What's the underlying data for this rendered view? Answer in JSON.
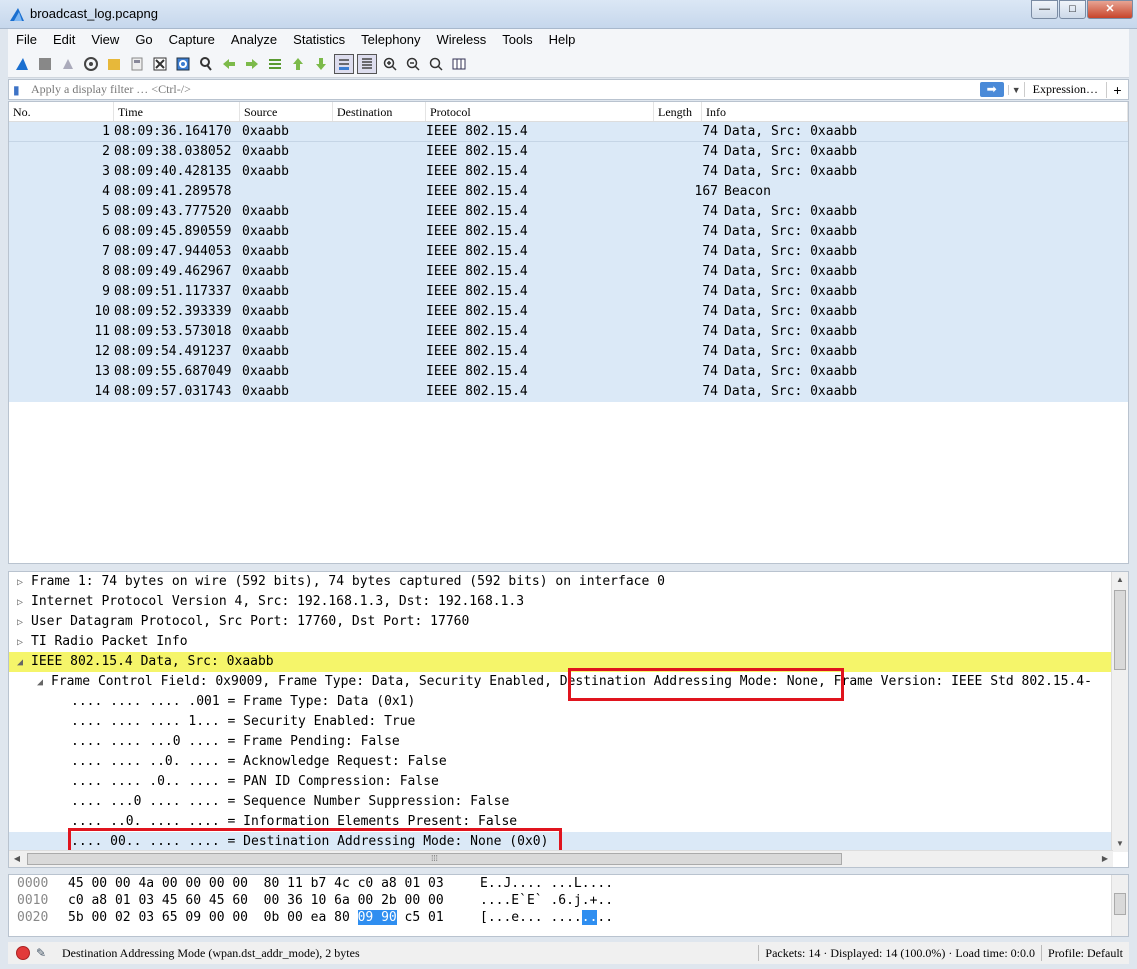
{
  "window": {
    "title": "broadcast_log.pcapng",
    "min": "—",
    "max": "□",
    "close": "✕"
  },
  "menu": [
    "File",
    "Edit",
    "View",
    "Go",
    "Capture",
    "Analyze",
    "Statistics",
    "Telephony",
    "Wireless",
    "Tools",
    "Help"
  ],
  "toolbar_icons": [
    "shark-start-icon",
    "stop-icon",
    "restart-icon",
    "options-icon",
    "open-icon",
    "save-icon",
    "close-file-icon",
    "reload-icon",
    "find-icon",
    "back-icon",
    "forward-icon",
    "goto-icon",
    "first-icon",
    "last-icon",
    "autoscroll-icon",
    "colorize-icon",
    "zoom-in-icon",
    "zoom-out-icon",
    "zoom-reset-icon",
    "resize-columns-icon"
  ],
  "filter": {
    "placeholder": "Apply a display filter … <Ctrl-/>",
    "expression": "Expression…",
    "plus": "+"
  },
  "columns": [
    "No.",
    "Time",
    "Source",
    "Destination",
    "Protocol",
    "Length",
    "Info"
  ],
  "packets": [
    {
      "no": "1",
      "time": "08:09:36.164170",
      "src": "0xaabb",
      "dst": "",
      "proto": "IEEE 802.15.4",
      "len": "74",
      "info": "Data, Src: 0xaabb"
    },
    {
      "no": "2",
      "time": "08:09:38.038052",
      "src": "0xaabb",
      "dst": "",
      "proto": "IEEE 802.15.4",
      "len": "74",
      "info": "Data, Src: 0xaabb"
    },
    {
      "no": "3",
      "time": "08:09:40.428135",
      "src": "0xaabb",
      "dst": "",
      "proto": "IEEE 802.15.4",
      "len": "74",
      "info": "Data, Src: 0xaabb"
    },
    {
      "no": "4",
      "time": "08:09:41.289578",
      "src": "",
      "dst": "",
      "proto": "IEEE 802.15.4",
      "len": "167",
      "info": "Beacon"
    },
    {
      "no": "5",
      "time": "08:09:43.777520",
      "src": "0xaabb",
      "dst": "",
      "proto": "IEEE 802.15.4",
      "len": "74",
      "info": "Data, Src: 0xaabb"
    },
    {
      "no": "6",
      "time": "08:09:45.890559",
      "src": "0xaabb",
      "dst": "",
      "proto": "IEEE 802.15.4",
      "len": "74",
      "info": "Data, Src: 0xaabb"
    },
    {
      "no": "7",
      "time": "08:09:47.944053",
      "src": "0xaabb",
      "dst": "",
      "proto": "IEEE 802.15.4",
      "len": "74",
      "info": "Data, Src: 0xaabb"
    },
    {
      "no": "8",
      "time": "08:09:49.462967",
      "src": "0xaabb",
      "dst": "",
      "proto": "IEEE 802.15.4",
      "len": "74",
      "info": "Data, Src: 0xaabb"
    },
    {
      "no": "9",
      "time": "08:09:51.117337",
      "src": "0xaabb",
      "dst": "",
      "proto": "IEEE 802.15.4",
      "len": "74",
      "info": "Data, Src: 0xaabb"
    },
    {
      "no": "10",
      "time": "08:09:52.393339",
      "src": "0xaabb",
      "dst": "",
      "proto": "IEEE 802.15.4",
      "len": "74",
      "info": "Data, Src: 0xaabb"
    },
    {
      "no": "11",
      "time": "08:09:53.573018",
      "src": "0xaabb",
      "dst": "",
      "proto": "IEEE 802.15.4",
      "len": "74",
      "info": "Data, Src: 0xaabb"
    },
    {
      "no": "12",
      "time": "08:09:54.491237",
      "src": "0xaabb",
      "dst": "",
      "proto": "IEEE 802.15.4",
      "len": "74",
      "info": "Data, Src: 0xaabb"
    },
    {
      "no": "13",
      "time": "08:09:55.687049",
      "src": "0xaabb",
      "dst": "",
      "proto": "IEEE 802.15.4",
      "len": "74",
      "info": "Data, Src: 0xaabb"
    },
    {
      "no": "14",
      "time": "08:09:57.031743",
      "src": "0xaabb",
      "dst": "",
      "proto": "IEEE 802.15.4",
      "len": "74",
      "info": "Data, Src: 0xaabb"
    }
  ],
  "details": [
    {
      "indent": 0,
      "arrow": "▷",
      "text": "Frame 1: 74 bytes on wire (592 bits), 74 bytes captured (592 bits) on interface 0",
      "style": ""
    },
    {
      "indent": 0,
      "arrow": "▷",
      "text": "Internet Protocol Version 4, Src: 192.168.1.3, Dst: 192.168.1.3",
      "style": ""
    },
    {
      "indent": 0,
      "arrow": "▷",
      "text": "User Datagram Protocol, Src Port: 17760, Dst Port: 17760",
      "style": ""
    },
    {
      "indent": 0,
      "arrow": "▷",
      "text": "TI Radio Packet Info",
      "style": ""
    },
    {
      "indent": 0,
      "arrow": "◢",
      "text": "IEEE 802.15.4 Data, Src: 0xaabb",
      "style": "hl"
    },
    {
      "indent": 1,
      "arrow": "◢",
      "text": "Frame Control Field: 0x9009, Frame Type: Data, Security Enabled, Destination Addressing Mode: None, Frame Version: IEEE Std 802.15.4-",
      "style": ""
    },
    {
      "indent": 2,
      "arrow": "",
      "text": ".... .... .... .001 = Frame Type: Data (0x1)",
      "style": ""
    },
    {
      "indent": 2,
      "arrow": "",
      "text": ".... .... .... 1... = Security Enabled: True",
      "style": ""
    },
    {
      "indent": 2,
      "arrow": "",
      "text": ".... .... ...0 .... = Frame Pending: False",
      "style": ""
    },
    {
      "indent": 2,
      "arrow": "",
      "text": ".... .... ..0. .... = Acknowledge Request: False",
      "style": ""
    },
    {
      "indent": 2,
      "arrow": "",
      "text": ".... .... .0.. .... = PAN ID Compression: False",
      "style": ""
    },
    {
      "indent": 2,
      "arrow": "",
      "text": ".... ...0 .... .... = Sequence Number Suppression: False",
      "style": ""
    },
    {
      "indent": 2,
      "arrow": "",
      "text": ".... ..0. .... .... = Information Elements Present: False",
      "style": ""
    },
    {
      "indent": 2,
      "arrow": "",
      "text": ".... 00.. .... .... = Destination Addressing Mode: None (0x0)",
      "style": "cur"
    }
  ],
  "bytes": [
    {
      "off": "0000",
      "hex1": "45 00 00 4a 00 00 00 00",
      "hex2": "80 11 b7 4c c0 a8 01 03",
      "hex2_sel": "",
      "hex2_rest": "",
      "ascii": "E..J.... ...L....",
      "ascii_sel": "",
      "ascii_rest": ""
    },
    {
      "off": "0010",
      "hex1": "c0 a8 01 03 45 60 45 60",
      "hex2": "00 36 10 6a 00 2b 00 00",
      "hex2_sel": "",
      "hex2_rest": "",
      "ascii": "....E`E` .6.j.+..",
      "ascii_sel": "",
      "ascii_rest": ""
    },
    {
      "off": "0020",
      "hex1": "5b 00 02 03 65 09 00 00",
      "hex2": "0b 00 ea 80 ",
      "hex2_sel": "09 90",
      "hex2_rest": " c5 01",
      "ascii": "[...e... ....",
      "ascii_sel": "..",
      "ascii_rest": ".."
    }
  ],
  "status": {
    "message": "Destination Addressing Mode (wpan.dst_addr_mode), 2 bytes",
    "packets": "Packets: 14 · Displayed: 14 (100.0%) · Load time: 0:0.0",
    "profile": "Profile: Default"
  },
  "colors": {
    "row_bg": "#dbe9f7",
    "highlight": "#f5f56a",
    "red_box": "#e0141e",
    "selected_bytes": "#2f8ef0"
  }
}
